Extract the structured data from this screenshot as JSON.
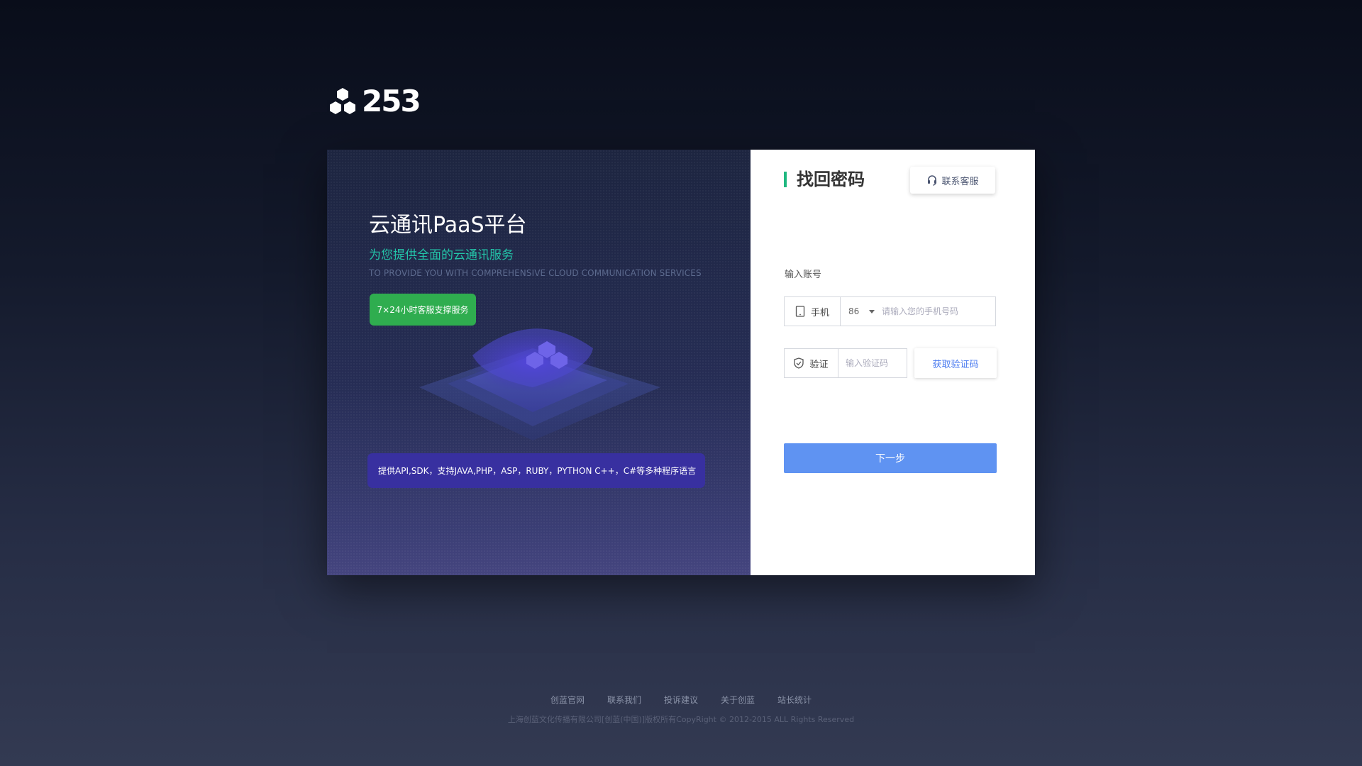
{
  "logo": {
    "text": "253",
    "icon": "hexagon-cluster-icon"
  },
  "left_panel": {
    "title": "云通讯PaaS平台",
    "subtitle": "为您提供全面的云通讯服务",
    "subtitle_en": "TO PROVIDE YOU WITH COMPREHENSIVE CLOUD COMMUNICATION SERVICES",
    "badge": "7×24小时客服支撑服务",
    "languages": "提供API,SDK，支持JAVA,PHP，ASP，RUBY，PYTHON C++，C#等多种程序语言",
    "colors": {
      "subtitle": "#23c4a8",
      "badge": "#2fad4f",
      "languages_bg": "#3830a0"
    }
  },
  "form": {
    "title": "找回密码",
    "support_label": "联系客服",
    "account_label": "输入账号",
    "phone_prefix_label": "手机",
    "country_code": "86",
    "phone_placeholder": "请输入您的手机号码",
    "code_prefix_label": "验证",
    "code_placeholder": "输入验证码",
    "get_code_label": "获取验证码",
    "next_label": "下一步",
    "colors": {
      "accent_bar": "#1fb880",
      "next_button": "#5f93f2",
      "link": "#4f7ef0"
    }
  },
  "footer": {
    "links": [
      "创蓝官网",
      "联系我们",
      "投诉建议",
      "关于创蓝",
      "站长统计"
    ],
    "copyright": "上海创蓝文化传播有限公司[创蓝(中国)]版权所有CopyRight © 2012-2015 ALL Rights Reserved"
  }
}
